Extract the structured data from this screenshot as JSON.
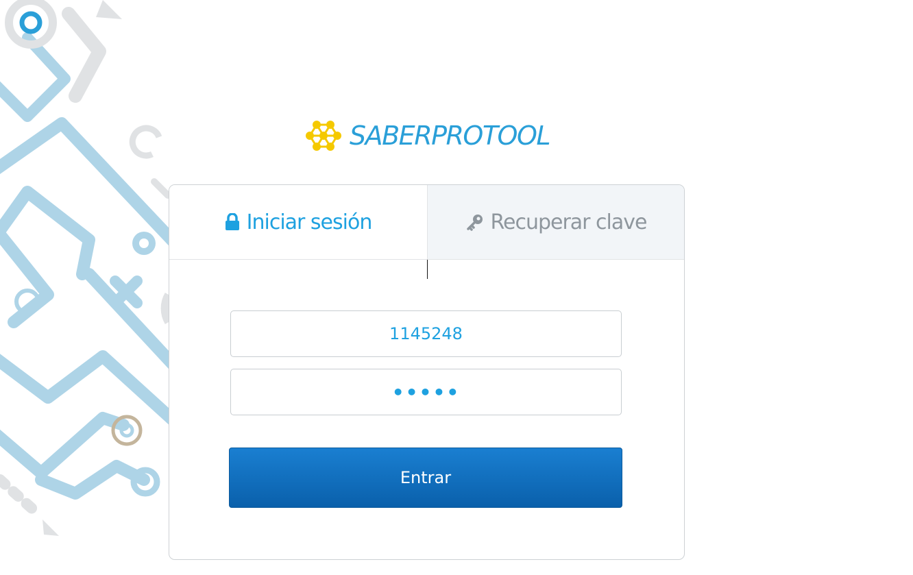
{
  "brand": {
    "name": "SABERPROTOOL",
    "logo_icon": "honeycomb-hexagon-icon",
    "colors": {
      "primary": "#2a9fd8",
      "logo_mark": "#f5c900"
    }
  },
  "tabs": {
    "login": {
      "label": "Iniciar sesión",
      "icon": "lock-icon"
    },
    "recover": {
      "label": "Recuperar clave",
      "icon": "key-icon"
    }
  },
  "form": {
    "username_value": "1145248",
    "password_value": "•••••"
  },
  "submit_label": "Entrar",
  "colors": {
    "accent": "#1ea1e0",
    "button": "#0f6cbb",
    "inactive_tab_bg": "#f2f5f8"
  }
}
